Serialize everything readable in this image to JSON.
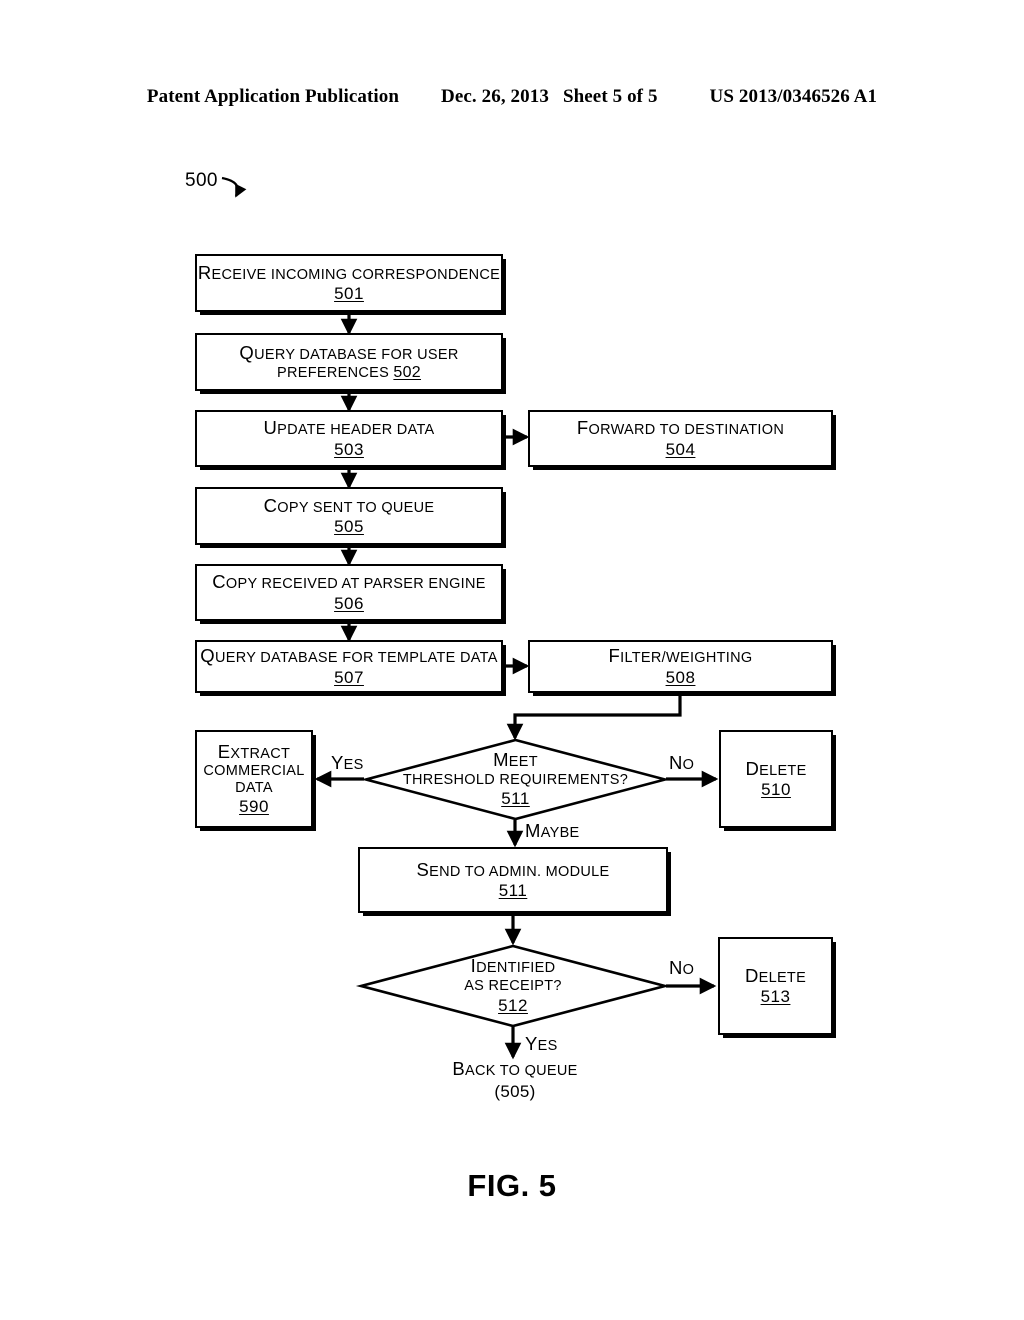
{
  "header": {
    "publication": "Patent Application Publication",
    "date": "Dec. 26, 2013",
    "sheet": "Sheet 5 of 5",
    "patent_number": "US 2013/0346526 A1"
  },
  "figure": {
    "reference_label": "500",
    "caption": "FIG. 5"
  },
  "nodes": {
    "n501": {
      "line1": "Receive incoming correspondence",
      "number": "501"
    },
    "n502": {
      "line1": "Query database for user",
      "line2": "preferences",
      "number": "502"
    },
    "n503": {
      "line1": "Update header data",
      "number": "503"
    },
    "n504": {
      "line1": "Forward to destination",
      "number": "504"
    },
    "n505": {
      "line1": "Copy sent to queue",
      "number": "505"
    },
    "n506": {
      "line1": "Copy received at parser engine",
      "number": "506"
    },
    "n507": {
      "line1": "Query database for template data",
      "number": "507"
    },
    "n508": {
      "line1": "Filter/weighting",
      "number": "508"
    },
    "n590": {
      "line1": "Extract",
      "line2": "commercial",
      "line3": "data",
      "number": "590"
    },
    "n510": {
      "line1": "Delete",
      "number": "510"
    },
    "n511d": {
      "line1": "Meet",
      "line2": "threshold requirements?",
      "number": "511"
    },
    "n511b": {
      "line1": "Send to admin. module",
      "number": "511"
    },
    "n512": {
      "line1": "Identified",
      "line2": "as receipt?",
      "number": "512"
    },
    "n513": {
      "line1": "Delete",
      "number": "513"
    }
  },
  "edge_labels": {
    "yes_threshold": "Yes",
    "no_threshold": "No",
    "maybe_threshold": "Maybe",
    "no_receipt": "No",
    "yes_receipt": "Yes"
  },
  "terminal": {
    "line1": "Back to queue",
    "line2": "(505)"
  }
}
